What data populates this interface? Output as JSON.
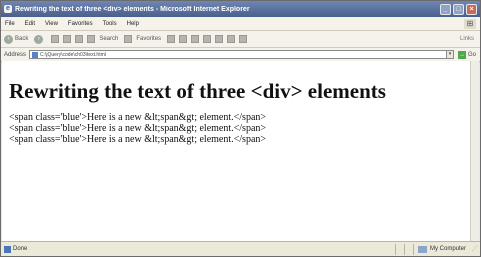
{
  "window": {
    "title": "Rewriting the text of three <div> elements - Microsoft Internet Explorer",
    "app_icon": "ie-icon"
  },
  "menu": {
    "items": [
      "File",
      "Edit",
      "View",
      "Favorites",
      "Tools",
      "Help"
    ]
  },
  "toolbar": {
    "back_label": "Back",
    "search_label": "Search",
    "favorites_label": "Favorites",
    "links_label": "Links"
  },
  "address": {
    "label": "Address",
    "value": "C:\\jQuery\\code\\ch03\\text.html",
    "go_label": "Go"
  },
  "page": {
    "heading": "Rewriting the text of three <div> elements",
    "lines": [
      "<span class='blue'>Here is a new &lt;span&gt; element.</span>",
      "<span class='blue'>Here is a new &lt;span&gt; element.</span>",
      "<span class='blue'>Here is a new &lt;span&gt; element.</span>"
    ]
  },
  "status": {
    "left": "Done",
    "zone": "My Computer"
  }
}
